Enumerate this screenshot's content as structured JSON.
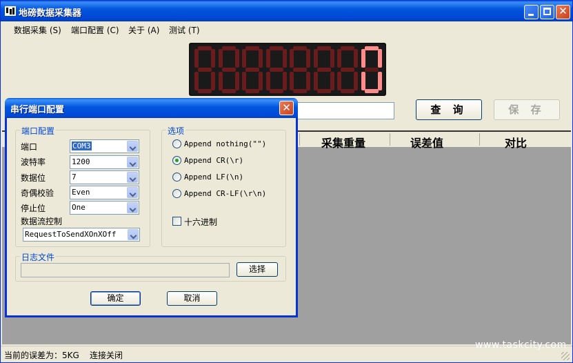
{
  "window": {
    "title": "地磅数据采集器"
  },
  "menu": [
    "数据采集 (S)",
    "端口配置 (C)",
    "关于 (A)",
    "测试 (T)"
  ],
  "display": {
    "value": "0",
    "digit_count": 8
  },
  "buttons": {
    "query": "查 询",
    "save": "保 存"
  },
  "grid": {
    "columns": [
      "采集重量",
      "误差值",
      "对比"
    ]
  },
  "status": {
    "error": "当前的误差为：5KG",
    "connection": "连接关闭"
  },
  "watermark": "www.taskcity.com",
  "dialog": {
    "title": "串行端口配置",
    "port_group": {
      "label": "端口配置",
      "fields": [
        {
          "label": "端口",
          "value": "COM3"
        },
        {
          "label": "波特率",
          "value": "1200"
        },
        {
          "label": "数据位",
          "value": "7"
        },
        {
          "label": "奇偶校验",
          "value": "Even"
        },
        {
          "label": "停止位",
          "value": "One"
        }
      ],
      "flow_label": "数据流控制",
      "flow_value": "RequestToSendXOnXOff"
    },
    "options_group": {
      "label": "选项",
      "radios": [
        {
          "label": "Append nothing(\"\")",
          "checked": false
        },
        {
          "label": "Append CR(\\r)",
          "checked": true
        },
        {
          "label": "Append LF(\\n)",
          "checked": false
        },
        {
          "label": "Append CR-LF(\\r\\n)",
          "checked": false
        }
      ],
      "hex_label": "十六进制",
      "hex_checked": false
    },
    "log_group": {
      "label": "日志文件",
      "browse": "选择"
    },
    "ok": "确定",
    "cancel": "取消"
  }
}
